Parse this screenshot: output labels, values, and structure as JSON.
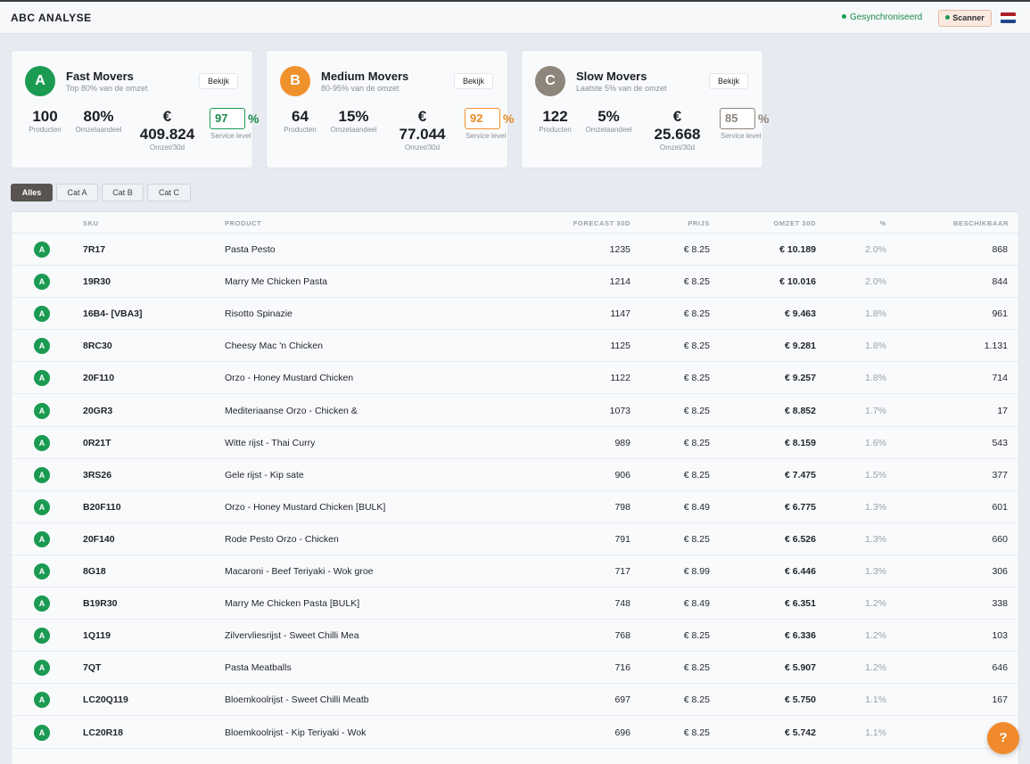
{
  "header": {
    "title": "ABC ANALYSE",
    "sync_status": "Gesynchroniseerd",
    "scanner_label": "Scanner"
  },
  "colors": {
    "a": "#1b9a52",
    "b": "#f0922c",
    "c": "#8e857b",
    "accent": "#f08a2c"
  },
  "cards": [
    {
      "letter": "A",
      "title": "Fast Movers",
      "subtitle": "Top 80% van de omzet",
      "view_label": "Bekijk",
      "products": "100",
      "products_label": "Producten",
      "share": "80%",
      "share_label": "Omzetaandeel",
      "revenue_cur": "€",
      "revenue": "409.824",
      "revenue_label": "Omzet/30d",
      "service_level": "97",
      "service_pct": "%",
      "service_label": "Service level"
    },
    {
      "letter": "B",
      "title": "Medium Movers",
      "subtitle": "80-95% van de omzet",
      "view_label": "Bekijk",
      "products": "64",
      "products_label": "Producten",
      "share": "15%",
      "share_label": "Omzetaandeel",
      "revenue_cur": "€",
      "revenue": "77.044",
      "revenue_label": "Omzet/30d",
      "service_level": "92",
      "service_pct": "%",
      "service_label": "Service level"
    },
    {
      "letter": "C",
      "title": "Slow Movers",
      "subtitle": "Laatste 5% van de omzet",
      "view_label": "Bekijk",
      "products": "122",
      "products_label": "Producten",
      "share": "5%",
      "share_label": "Omzetaandeel",
      "revenue_cur": "€",
      "revenue": "25.668",
      "revenue_label": "Omzet/30d",
      "service_level": "85",
      "service_pct": "%",
      "service_label": "Service level"
    }
  ],
  "filters": [
    "Alles",
    "Cat A",
    "Cat B",
    "Cat C"
  ],
  "table": {
    "columns": [
      "SKU",
      "PRODUCT",
      "FORECAST 30D",
      "PRIJS",
      "OMZET 30D",
      "%",
      "BESCHIKBAAR"
    ],
    "rows": [
      {
        "cat": "A",
        "sku": "7R17",
        "product": "Pasta Pesto",
        "forecast": "1235",
        "price": "€ 8.25",
        "revenue": "€ 10.189",
        "pct": "2.0%",
        "available": "868"
      },
      {
        "cat": "A",
        "sku": "19R30",
        "product": "Marry Me Chicken Pasta",
        "forecast": "1214",
        "price": "€ 8.25",
        "revenue": "€ 10.016",
        "pct": "2.0%",
        "available": "844"
      },
      {
        "cat": "A",
        "sku": "16B4- [VBA3]",
        "product": "Risotto Spinazie",
        "forecast": "1147",
        "price": "€ 8.25",
        "revenue": "€ 9.463",
        "pct": "1.8%",
        "available": "961"
      },
      {
        "cat": "A",
        "sku": "8RC30",
        "product": "Cheesy Mac 'n Chicken",
        "forecast": "1125",
        "price": "€ 8.25",
        "revenue": "€ 9.281",
        "pct": "1.8%",
        "available": "1.131"
      },
      {
        "cat": "A",
        "sku": "20F110",
        "product": "Orzo - Honey Mustard Chicken",
        "forecast": "1122",
        "price": "€ 8.25",
        "revenue": "€ 9.257",
        "pct": "1.8%",
        "available": "714"
      },
      {
        "cat": "A",
        "sku": "20GR3",
        "product": "Mediteriaanse Orzo - Chicken &",
        "forecast": "1073",
        "price": "€ 8.25",
        "revenue": "€ 8.852",
        "pct": "1.7%",
        "available": "17"
      },
      {
        "cat": "A",
        "sku": "0R21T",
        "product": "Witte rijst - Thai Curry",
        "forecast": "989",
        "price": "€ 8.25",
        "revenue": "€ 8.159",
        "pct": "1.6%",
        "available": "543"
      },
      {
        "cat": "A",
        "sku": "3RS26",
        "product": "Gele rijst - Kip sate",
        "forecast": "906",
        "price": "€ 8.25",
        "revenue": "€ 7.475",
        "pct": "1.5%",
        "available": "377"
      },
      {
        "cat": "A",
        "sku": "B20F110",
        "product": "Orzo - Honey Mustard Chicken [BULK]",
        "forecast": "798",
        "price": "€ 8.49",
        "revenue": "€ 6.775",
        "pct": "1.3%",
        "available": "601"
      },
      {
        "cat": "A",
        "sku": "20F140",
        "product": "Rode Pesto Orzo - Chicken",
        "forecast": "791",
        "price": "€ 8.25",
        "revenue": "€ 6.526",
        "pct": "1.3%",
        "available": "660"
      },
      {
        "cat": "A",
        "sku": "8G18",
        "product": "Macaroni - Beef Teriyaki - Wok groe",
        "forecast": "717",
        "price": "€ 8.99",
        "revenue": "€ 6.446",
        "pct": "1.3%",
        "available": "306"
      },
      {
        "cat": "A",
        "sku": "B19R30",
        "product": "Marry Me Chicken Pasta [BULK]",
        "forecast": "748",
        "price": "€ 8.49",
        "revenue": "€ 6.351",
        "pct": "1.2%",
        "available": "338"
      },
      {
        "cat": "A",
        "sku": "1Q119",
        "product": "Zilvervliesrijst - Sweet Chilli Mea",
        "forecast": "768",
        "price": "€ 8.25",
        "revenue": "€ 6.336",
        "pct": "1.2%",
        "available": "103"
      },
      {
        "cat": "A",
        "sku": "7QT",
        "product": "Pasta Meatballs",
        "forecast": "716",
        "price": "€ 8.25",
        "revenue": "€ 5.907",
        "pct": "1.2%",
        "available": "646"
      },
      {
        "cat": "A",
        "sku": "LC20Q119",
        "product": "Bloemkoolrijst - Sweet Chilli Meatb",
        "forecast": "697",
        "price": "€ 8.25",
        "revenue": "€ 5.750",
        "pct": "1.1%",
        "available": "167"
      },
      {
        "cat": "A",
        "sku": "LC20R18",
        "product": "Bloemkoolrijst - Kip Teriyaki - Wok",
        "forecast": "696",
        "price": "€ 8.25",
        "revenue": "€ 5.742",
        "pct": "1.1%",
        "available": ""
      }
    ]
  },
  "help_label": "?"
}
